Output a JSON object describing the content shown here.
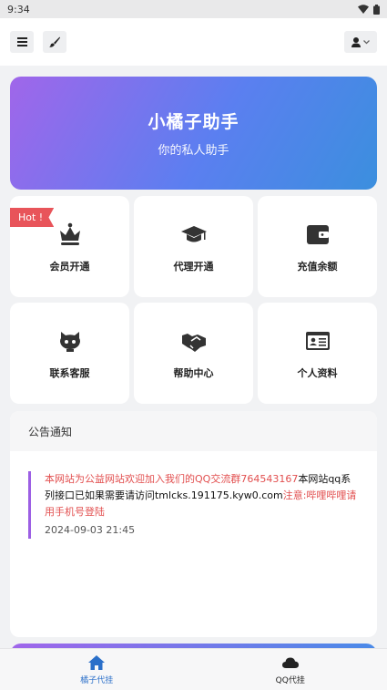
{
  "status": {
    "time": "9:34"
  },
  "banner": {
    "title": "小橘子助手",
    "subtitle": "你的私人助手"
  },
  "grid": {
    "hot_badge": "Hot !",
    "items": [
      {
        "label": "会员开通",
        "icon": "crown-icon"
      },
      {
        "label": "代理开通",
        "icon": "graduation-cap-icon"
      },
      {
        "label": "充值余额",
        "icon": "wallet-icon"
      },
      {
        "label": "联系客服",
        "icon": "github-cat-icon"
      },
      {
        "label": "帮助中心",
        "icon": "handshake-icon"
      },
      {
        "label": "个人资料",
        "icon": "id-card-icon"
      }
    ]
  },
  "notice": {
    "title": "公告通知",
    "seg1": "本网站为公益网站欢迎加入我们的QQ交流群",
    "seg2": "764543167",
    "seg3": "本网站qq系列接口已如果需要请访问tmlcks.191175.kyw0.com",
    "seg4": "注意:哔哩哔哩请用手机号登陆",
    "time": "2024-09-03 21:45"
  },
  "bottom_nav": [
    {
      "label": "橘子代挂",
      "active": true
    },
    {
      "label": "QQ代挂",
      "active": false
    }
  ],
  "colors": {
    "accent": "#2a6fc9",
    "hot": "#e8545a",
    "notice_bar": "#9c5fe4"
  }
}
